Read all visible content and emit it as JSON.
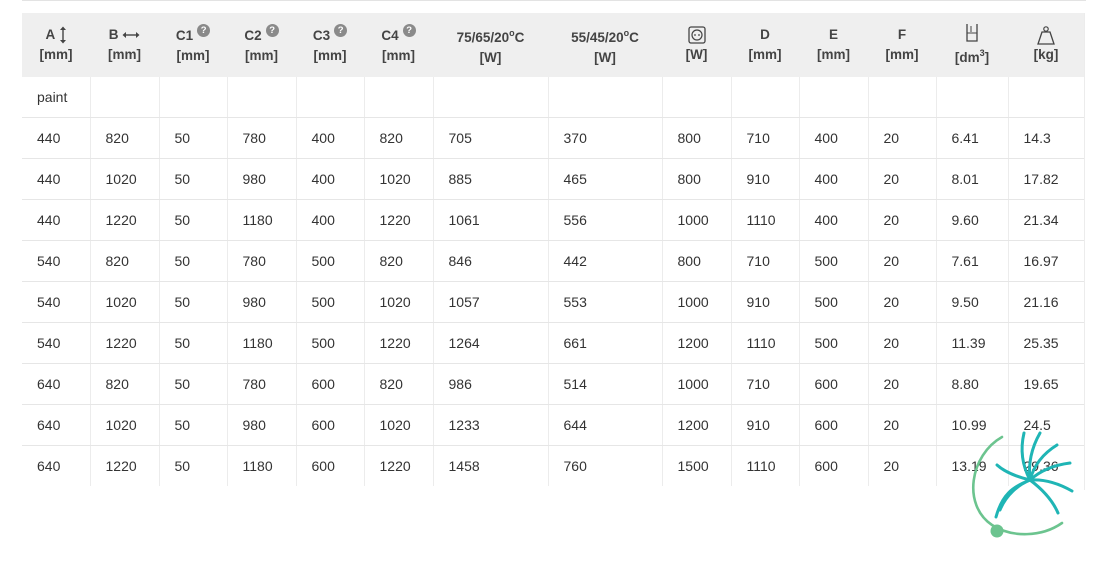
{
  "headers": [
    {
      "name": "A",
      "icon": "height-arrow-icon",
      "unit": "[mm]"
    },
    {
      "name": "B",
      "icon": "width-arrow-icon",
      "unit": "[mm]"
    },
    {
      "name": "C1",
      "help": "?",
      "unit": "[mm]"
    },
    {
      "name": "C2",
      "help": "?",
      "unit": "[mm]"
    },
    {
      "name": "C3",
      "help": "?",
      "unit": "[mm]"
    },
    {
      "name": "C4",
      "help": "?",
      "unit": "[mm]"
    },
    {
      "name": "75/65/20",
      "sup": "o",
      "suffix": "C",
      "unit": "[W]"
    },
    {
      "name": "55/45/20",
      "sup": "o",
      "suffix": "C",
      "unit": "[W]"
    },
    {
      "name": "",
      "icon": "socket-icon",
      "unit": "[W]"
    },
    {
      "name": "D",
      "unit": "[mm]"
    },
    {
      "name": "E",
      "unit": "[mm]"
    },
    {
      "name": "F",
      "unit": "[mm]"
    },
    {
      "name": "",
      "icon": "volume-container-icon",
      "unit": "[dm",
      "unit_sup": "3",
      "unit_suffix": "]"
    },
    {
      "name": "",
      "icon": "weight-icon",
      "unit": "[kg]"
    }
  ],
  "section_label": "paint",
  "rows": [
    [
      "440",
      "820",
      "50",
      "780",
      "400",
      "820",
      "705",
      "370",
      "800",
      "710",
      "400",
      "20",
      "6.41",
      "14.3"
    ],
    [
      "440",
      "1020",
      "50",
      "980",
      "400",
      "1020",
      "885",
      "465",
      "800",
      "910",
      "400",
      "20",
      "8.01",
      "17.82"
    ],
    [
      "440",
      "1220",
      "50",
      "1180",
      "400",
      "1220",
      "1061",
      "556",
      "1000",
      "1110",
      "400",
      "20",
      "9.60",
      "21.34"
    ],
    [
      "540",
      "820",
      "50",
      "780",
      "500",
      "820",
      "846",
      "442",
      "800",
      "710",
      "500",
      "20",
      "7.61",
      "16.97"
    ],
    [
      "540",
      "1020",
      "50",
      "980",
      "500",
      "1020",
      "1057",
      "553",
      "1000",
      "910",
      "500",
      "20",
      "9.50",
      "21.16"
    ],
    [
      "540",
      "1220",
      "50",
      "1180",
      "500",
      "1220",
      "1264",
      "661",
      "1200",
      "1110",
      "500",
      "20",
      "11.39",
      "25.35"
    ],
    [
      "640",
      "820",
      "50",
      "780",
      "600",
      "820",
      "986",
      "514",
      "1000",
      "710",
      "600",
      "20",
      "8.80",
      "19.65"
    ],
    [
      "640",
      "1020",
      "50",
      "980",
      "600",
      "1020",
      "1233",
      "644",
      "1200",
      "910",
      "600",
      "20",
      "10.99",
      "24.5"
    ],
    [
      "640",
      "1220",
      "50",
      "1180",
      "600",
      "1220",
      "1458",
      "760",
      "1500",
      "1110",
      "600",
      "20",
      "13.19",
      "29.36"
    ]
  ],
  "colors": {
    "header_bg": "#efefef",
    "logo_teal": "#1fb5b5",
    "logo_green": "#6cc48f"
  },
  "logo_icon": "brand-logo-icon"
}
